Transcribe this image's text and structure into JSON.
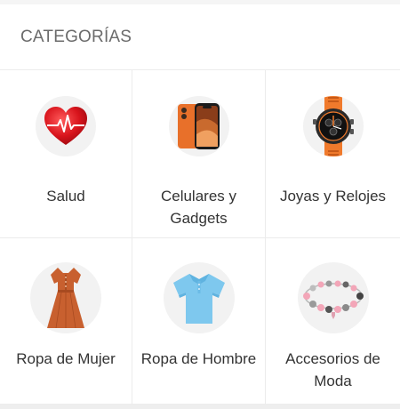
{
  "section": {
    "title": "CATEGORÍAS"
  },
  "categories": [
    {
      "label": "Salud",
      "icon": "heart-pulse-icon"
    },
    {
      "label": "Celulares y Gadgets",
      "icon": "smartphone-icon"
    },
    {
      "label": "Joyas y Relojes",
      "icon": "wristwatch-icon"
    },
    {
      "label": "Ropa de Mujer",
      "icon": "dress-icon"
    },
    {
      "label": "Ropa de Hombre",
      "icon": "polo-shirt-icon"
    },
    {
      "label": "Accesorios de Moda",
      "icon": "charm-bracelet-icon"
    }
  ],
  "colors": {
    "heart": "#d8141c",
    "phone": "#e8702a",
    "watch_band": "#f07a2c",
    "dress": "#c8602f",
    "polo": "#7ec8ee",
    "bracelet_beads": "#f3a6b8"
  }
}
